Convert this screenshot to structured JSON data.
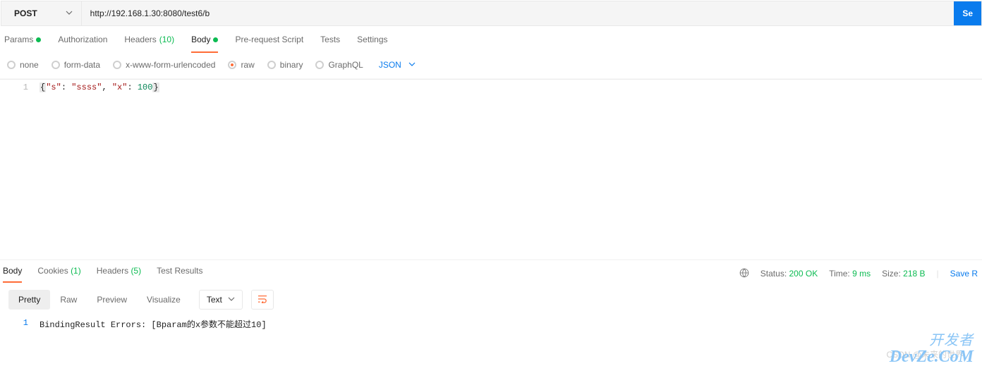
{
  "request": {
    "method": "POST",
    "url": "http://192.168.1.30:8080/test6/b",
    "send_label": "Se"
  },
  "tabs": {
    "params": {
      "label": "Params",
      "has_dot": true
    },
    "authorization": {
      "label": "Authorization"
    },
    "headers": {
      "label": "Headers",
      "count": "(10)"
    },
    "body": {
      "label": "Body",
      "has_dot": true,
      "active": true
    },
    "prerequest": {
      "label": "Pre-request Script"
    },
    "tests": {
      "label": "Tests"
    },
    "settings": {
      "label": "Settings"
    }
  },
  "body_types": {
    "none": "none",
    "form_data": "form-data",
    "urlencoded": "x-www-form-urlencoded",
    "raw": "raw",
    "binary": "binary",
    "graphql": "GraphQL",
    "raw_format": "JSON"
  },
  "request_body": {
    "line_no": "1",
    "open_brace": "{",
    "key1": "\"s\"",
    "colon1": ": ",
    "val1": "\"ssss\"",
    "comma": ", ",
    "key2": "\"x\"",
    "colon2": ": ",
    "val2": "100",
    "close_brace": "}"
  },
  "response": {
    "tabs": {
      "body": {
        "label": "Body",
        "active": true
      },
      "cookies": {
        "label": "Cookies",
        "count": "(1)"
      },
      "headers": {
        "label": "Headers",
        "count": "(5)"
      },
      "test_results": {
        "label": "Test Results"
      }
    },
    "status_label": "Status:",
    "status_value": "200 OK",
    "time_label": "Time:",
    "time_value": "9 ms",
    "size_label": "Size:",
    "size_value": "218 B",
    "save_label": "Save R",
    "view": {
      "pretty": "Pretty",
      "raw": "Raw",
      "preview": "Preview",
      "visualize": "Visualize",
      "format": "Text"
    },
    "body": {
      "line_no": "1",
      "text": "BindingResult Errors: [Bparam的x参数不能超过10]"
    }
  },
  "watermark": {
    "line1": "开发者",
    "line2": "DevZe.CoM",
    "csdn": "CSDN @未来的世界"
  }
}
